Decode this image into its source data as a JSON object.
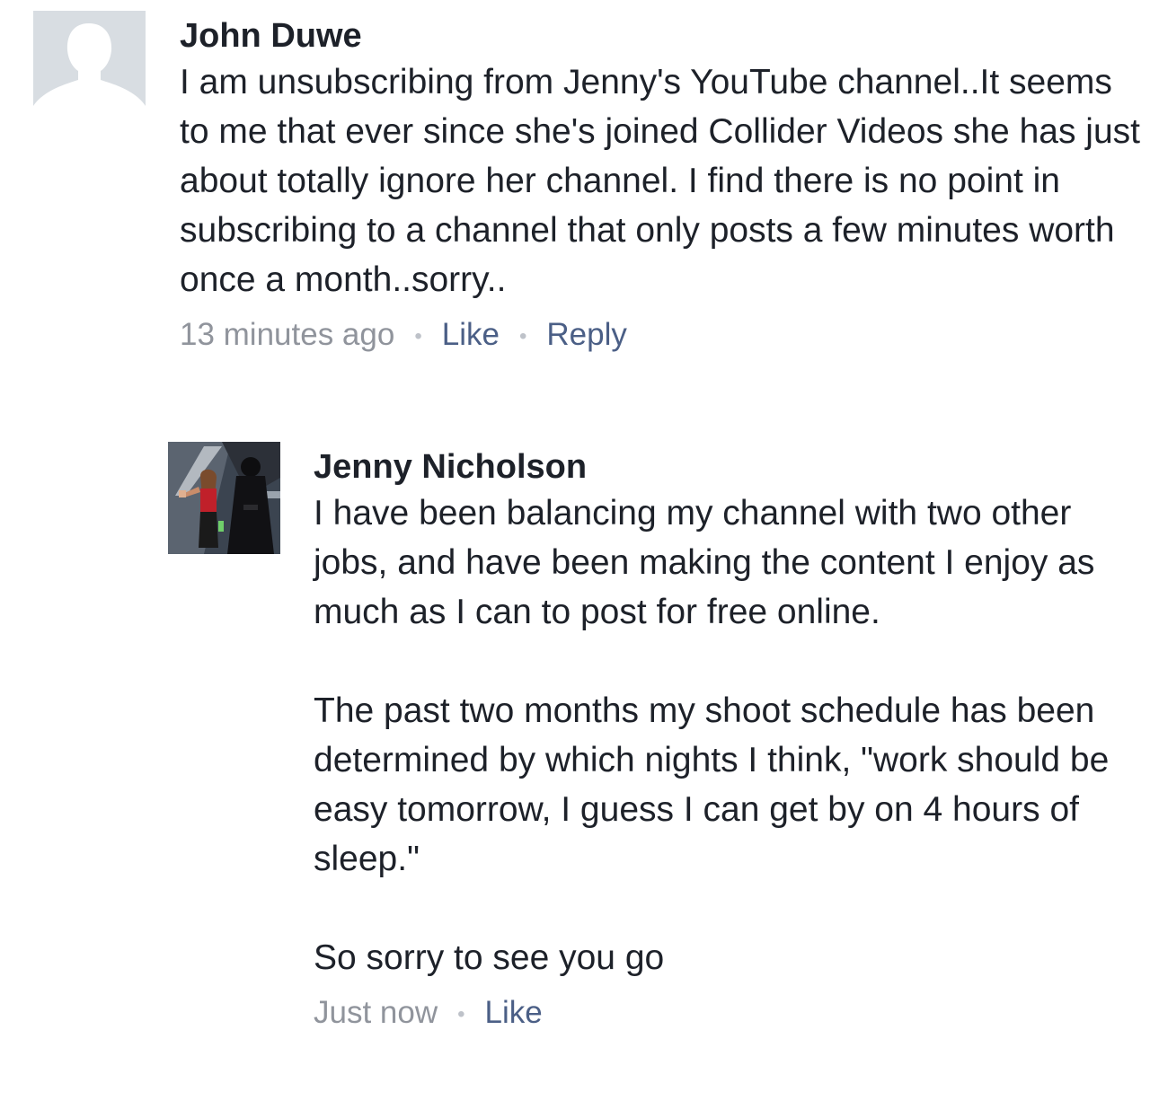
{
  "comments": [
    {
      "author": "John Duwe",
      "avatar_icon": "default-profile-silhouette-icon",
      "text": "I am unsubscribing from Jenny's YouTube channel..It seems to me that ever since she's joined Collider Videos she has just about totally ignore her channel. I find there is no point in subscribing to a channel that only posts a few minutes worth once a month..sorry..",
      "time": "13 minutes ago",
      "like_label": "Like",
      "reply_label": "Reply"
    },
    {
      "author": "Jenny Nicholson",
      "avatar_icon": "profile-photo",
      "text": "I have been balancing my channel with two other jobs, and have been making the content I enjoy as much as I can to post for free online.\n\nThe past two months my shoot schedule has been determined by which nights I think, \"work should be easy tomorrow, I guess I can get by on 4 hours of sleep.\"\n\nSo sorry to see you go",
      "time": "Just now",
      "like_label": "Like"
    }
  ],
  "separator": "•",
  "colors": {
    "text": "#1d2129",
    "meta_time": "#90949c",
    "link": "#4b5f86",
    "avatar_placeholder": "#d8dde2"
  }
}
